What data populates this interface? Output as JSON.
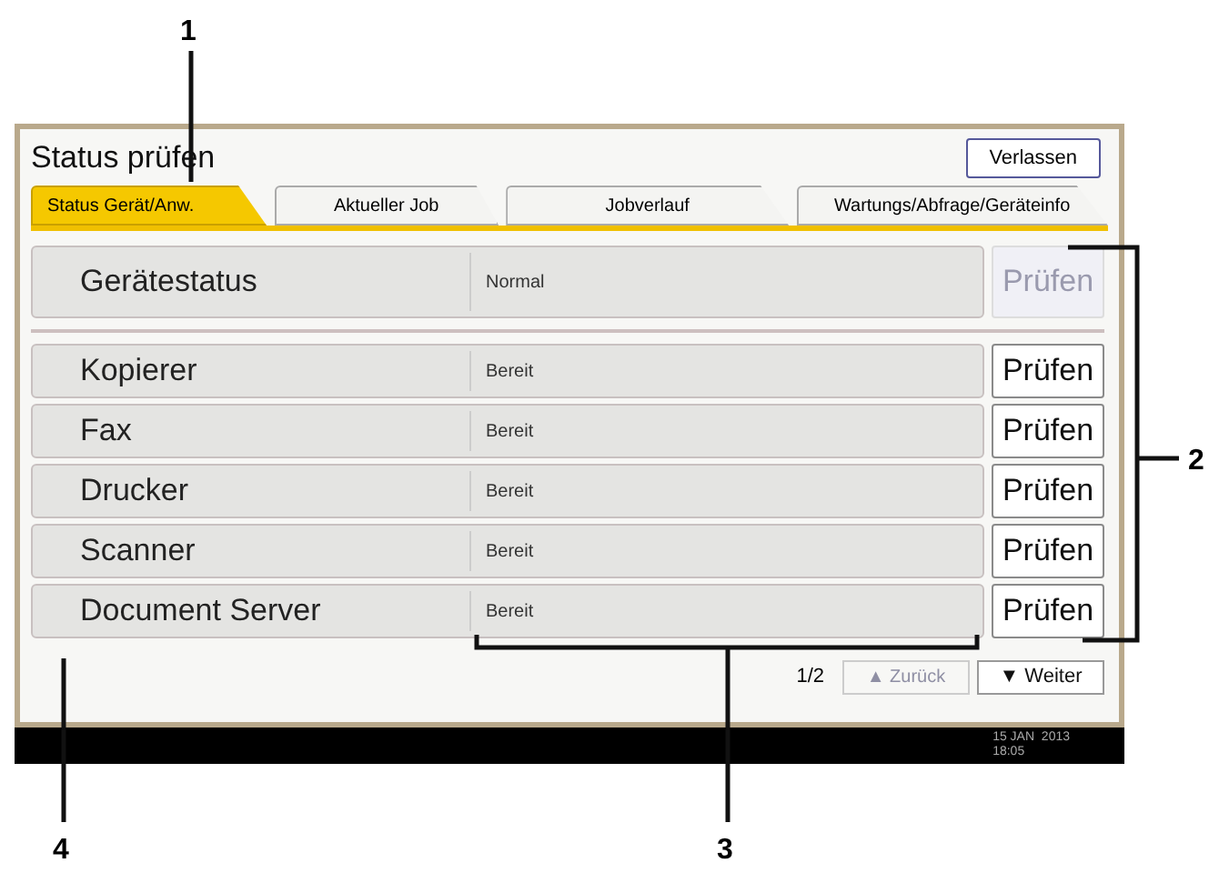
{
  "screen": {
    "title": "Status prüfen",
    "exit_button": "Verlassen",
    "tabs": [
      {
        "label": "Status Gerät/Anw.",
        "selected": true
      },
      {
        "label": "Aktueller Job",
        "selected": false
      },
      {
        "label": "Jobverlauf",
        "selected": false
      },
      {
        "label": "Wartungs/Abfrage/Geräteinfo",
        "selected": false
      }
    ],
    "device_status": {
      "name": "Gerätestatus",
      "status": "Normal",
      "button": "Prüfen",
      "disabled": true
    },
    "functions": [
      {
        "name": "Kopierer",
        "status": "Bereit",
        "button": "Prüfen",
        "disabled": false
      },
      {
        "name": "Fax",
        "status": "Bereit",
        "button": "Prüfen",
        "disabled": false
      },
      {
        "name": "Drucker",
        "status": "Bereit",
        "button": "Prüfen",
        "disabled": false
      },
      {
        "name": "Scanner",
        "status": "Bereit",
        "button": "Prüfen",
        "disabled": false
      },
      {
        "name": "Document Server",
        "status": "Bereit",
        "button": "Prüfen",
        "disabled": false
      }
    ],
    "pager": {
      "page": "1/2",
      "prev": {
        "label": "▲ Zurück",
        "disabled": true
      },
      "next": {
        "label": "▼ Weiter",
        "disabled": false
      }
    },
    "status_bar": {
      "date": "15 JAN  2013",
      "time": "18:05"
    }
  },
  "callouts": [
    {
      "label": "1"
    },
    {
      "label": "2"
    },
    {
      "label": "3"
    },
    {
      "label": "4"
    }
  ]
}
